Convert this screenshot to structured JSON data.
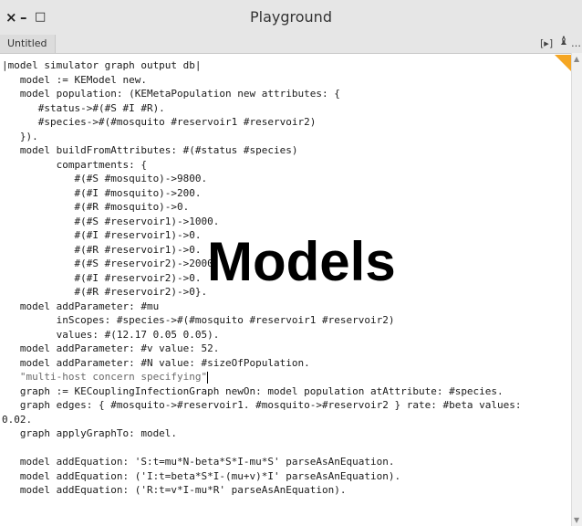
{
  "window": {
    "title": "Playground",
    "close_glyph": "×",
    "minimize_glyph": "–",
    "maximize_glyph": "□"
  },
  "tab": {
    "label": "Untitled"
  },
  "toolbar": {
    "run_glyph": "[▸]",
    "more_glyph": "…"
  },
  "code_lines": [
    "|model simulator graph output db|",
    "   model := KEModel new.",
    "   model population: (KEMetaPopulation new attributes: {",
    "      #status->#(#S #I #R).",
    "      #species->#(#mosquito #reservoir1 #reservoir2)",
    "   }).",
    "   model buildFromAttributes: #(#status #species)",
    "         compartments: {",
    "            #(#S #mosquito)->9800.",
    "            #(#I #mosquito)->200.",
    "            #(#R #mosquito)->0.",
    "            #(#S #reservoir1)->1000.",
    "            #(#I #reservoir1)->0.",
    "            #(#R #reservoir1)->0.",
    "            #(#S #reservoir2)->2000.",
    "            #(#I #reservoir2)->0.",
    "            #(#R #reservoir2)->0}.",
    "   model addParameter: #mu",
    "         inScopes: #species->#(#mosquito #reservoir1 #reservoir2)",
    "         values: #(12.17 0.05 0.05).",
    "   model addParameter: #v value: 52.",
    "   model addParameter: #N value: #sizeOfPopulation.",
    "   \"multi-host concern specifying\"",
    "   graph := KECouplingInfectionGraph newOn: model population atAttribute: #species.",
    "   graph edges: { #mosquito->#reservoir1. #mosquito->#reservoir2 } rate: #beta values:",
    "0.02.",
    "   graph applyGraphTo: model.",
    "",
    "   model addEquation: 'S:t=mu*N-beta*S*I-mu*S' parseAsAnEquation.",
    "   model addEquation: ('I:t=beta*S*I-(mu+v)*I' parseAsAnEquation).",
    "   model addEquation: ('R:t=v*I-mu*R' parseAsAnEquation)."
  ],
  "overlay_text": "Models",
  "colors": {
    "accent_corner": "#f5a623",
    "titlebar_bg": "#e6e6e6"
  }
}
